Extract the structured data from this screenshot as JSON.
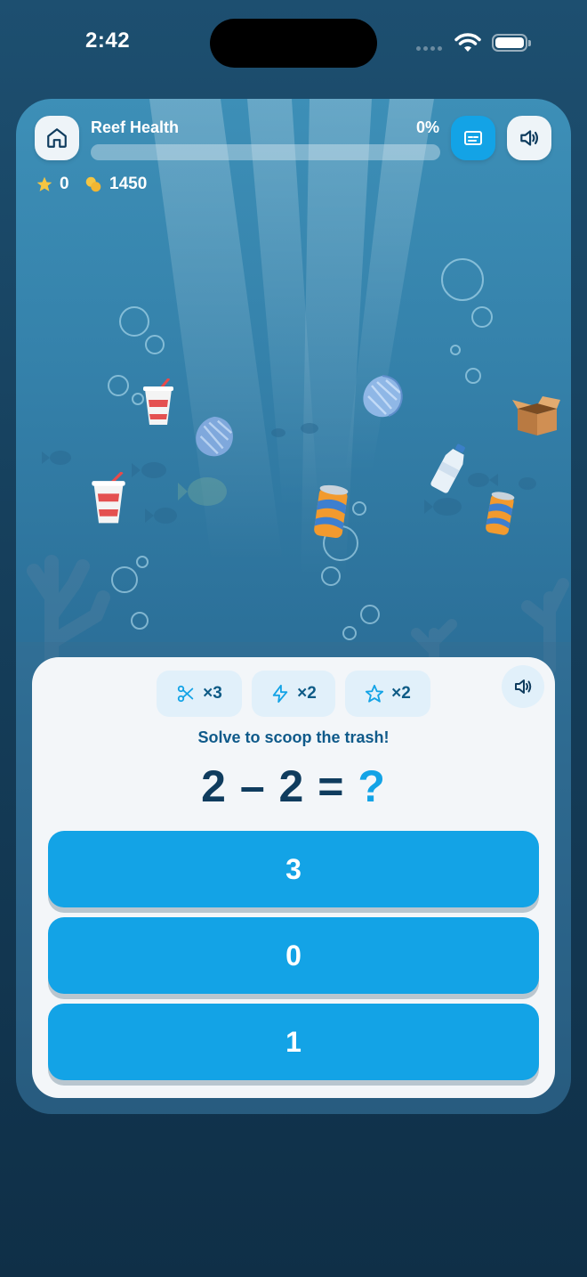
{
  "status_bar": {
    "time": "2:42"
  },
  "hud": {
    "title": "Reef Health",
    "percent": "0%",
    "progress": 0,
    "stars": "0",
    "coins": "1450"
  },
  "quiz": {
    "powerups": [
      {
        "icon": "scissors-icon",
        "label": "×3"
      },
      {
        "icon": "lightning-icon",
        "label": "×2"
      },
      {
        "icon": "star-outline-icon",
        "label": "×2"
      }
    ],
    "prompt": "Solve to scoop the trash!",
    "equation": {
      "left": "2 – 2 = ",
      "unknown": "?"
    },
    "answers": [
      "3",
      "0",
      "1"
    ]
  },
  "colors": {
    "accent": "#13a3e6",
    "panel": "#f3f6f9",
    "equation_text": "#0f3c5e"
  }
}
